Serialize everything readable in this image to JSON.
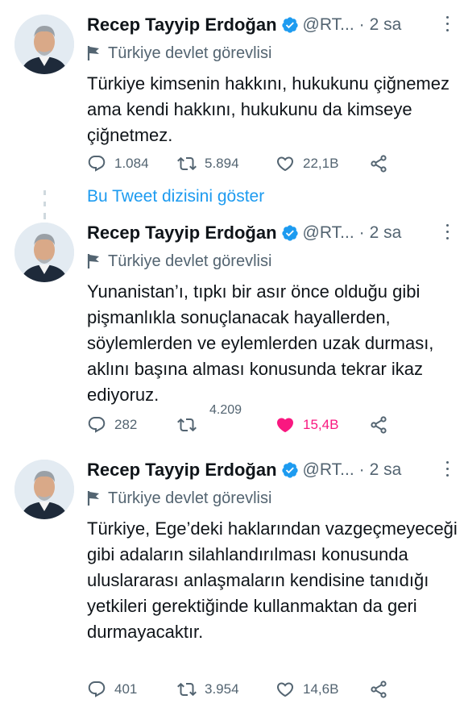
{
  "tweets": [
    {
      "author": "Recep Tayyip Erdoğan",
      "handle": "@RT...",
      "separator": "·",
      "time": "2 sa",
      "label": "Türkiye devlet görevlisi",
      "text": "Türkiye kimsenin hakkını, hukukunu çiğnemez ama kendi hakkını, hukukunu da kimseye çiğnetmez.",
      "replies": "1.084",
      "retweets": "5.894",
      "likes": "22,1B",
      "liked": false
    },
    {
      "author": "Recep Tayyip Erdoğan",
      "handle": "@RT...",
      "separator": "·",
      "time": "2 sa",
      "label": "Türkiye devlet görevlisi",
      "text": "Yunanistan’ı, tıpkı bir asır önce olduğu gibi pişmanlıkla sonuçlanacak hayallerden, söylemlerden ve eylemlerden uzak durması, aklını başına alması konusunda tekrar ikaz ediyoruz.",
      "replies": "282",
      "retweets": "4.209",
      "likes": "15,4B",
      "liked": true
    },
    {
      "author": "Recep Tayyip Erdoğan",
      "handle": "@RT...",
      "separator": "·",
      "time": "2 sa",
      "label": "Türkiye devlet görevlisi",
      "text": "Türkiye, Ege’deki haklarından vazgeçmeyeceği gibi adaların silahlandırılması konusunda uluslararası anlaşmaların kendisine tanıdığı yetkileri gerektiğinde kullanmaktan da geri durmayacaktır.",
      "replies": "401",
      "retweets": "3.954",
      "likes": "14,6B",
      "liked": false
    }
  ],
  "thread_link": "Bu Tweet dizisini göster",
  "colors": {
    "text": "#0f1419",
    "secondary": "#536471",
    "link": "#1d9bf0",
    "like": "#f91880",
    "verified": "#1d9bf0"
  },
  "icons": [
    "verified-badge-icon",
    "flag-icon",
    "reply-icon",
    "retweet-icon",
    "like-icon",
    "share-icon",
    "more-icon"
  ]
}
